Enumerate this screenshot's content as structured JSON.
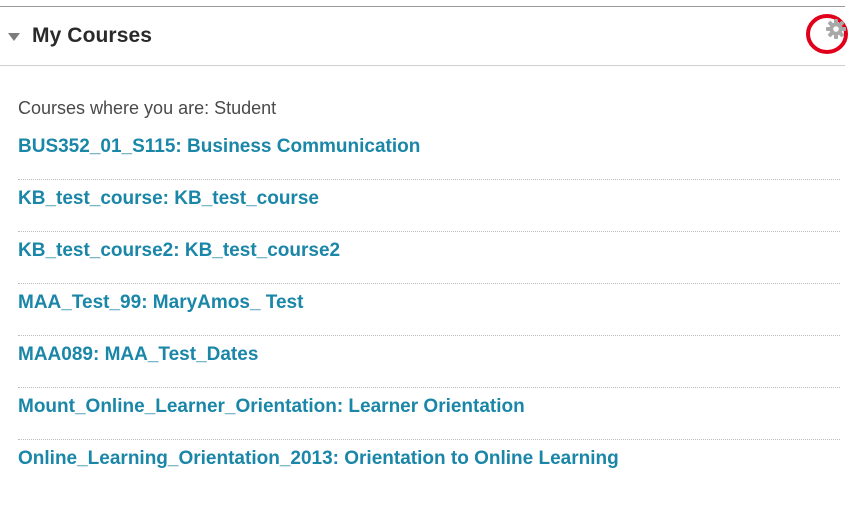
{
  "block": {
    "title": "My Courses",
    "role_heading": "Courses where you are: Student"
  },
  "courses": [
    {
      "label": "BUS352_01_S115: Business Communication"
    },
    {
      "label": "KB_test_course: KB_test_course"
    },
    {
      "label": "KB_test_course2: KB_test_course2"
    },
    {
      "label": "MAA_Test_99: MaryAmos_ Test"
    },
    {
      "label": "MAA089: MAA_Test_Dates"
    },
    {
      "label": "Mount_Online_Learner_Orientation: Learner Orientation"
    },
    {
      "label": "Online_Learning_Orientation_2013: Orientation to Online Learning"
    }
  ],
  "icons": {
    "collapse": "triangle-down-icon",
    "settings": "gear-icon",
    "highlight": "red-circle-annotation"
  },
  "colors": {
    "link": "#1a86a8",
    "title": "#2a2a2a",
    "gear": "#a8a8a8",
    "annotation": "#e0001b"
  }
}
